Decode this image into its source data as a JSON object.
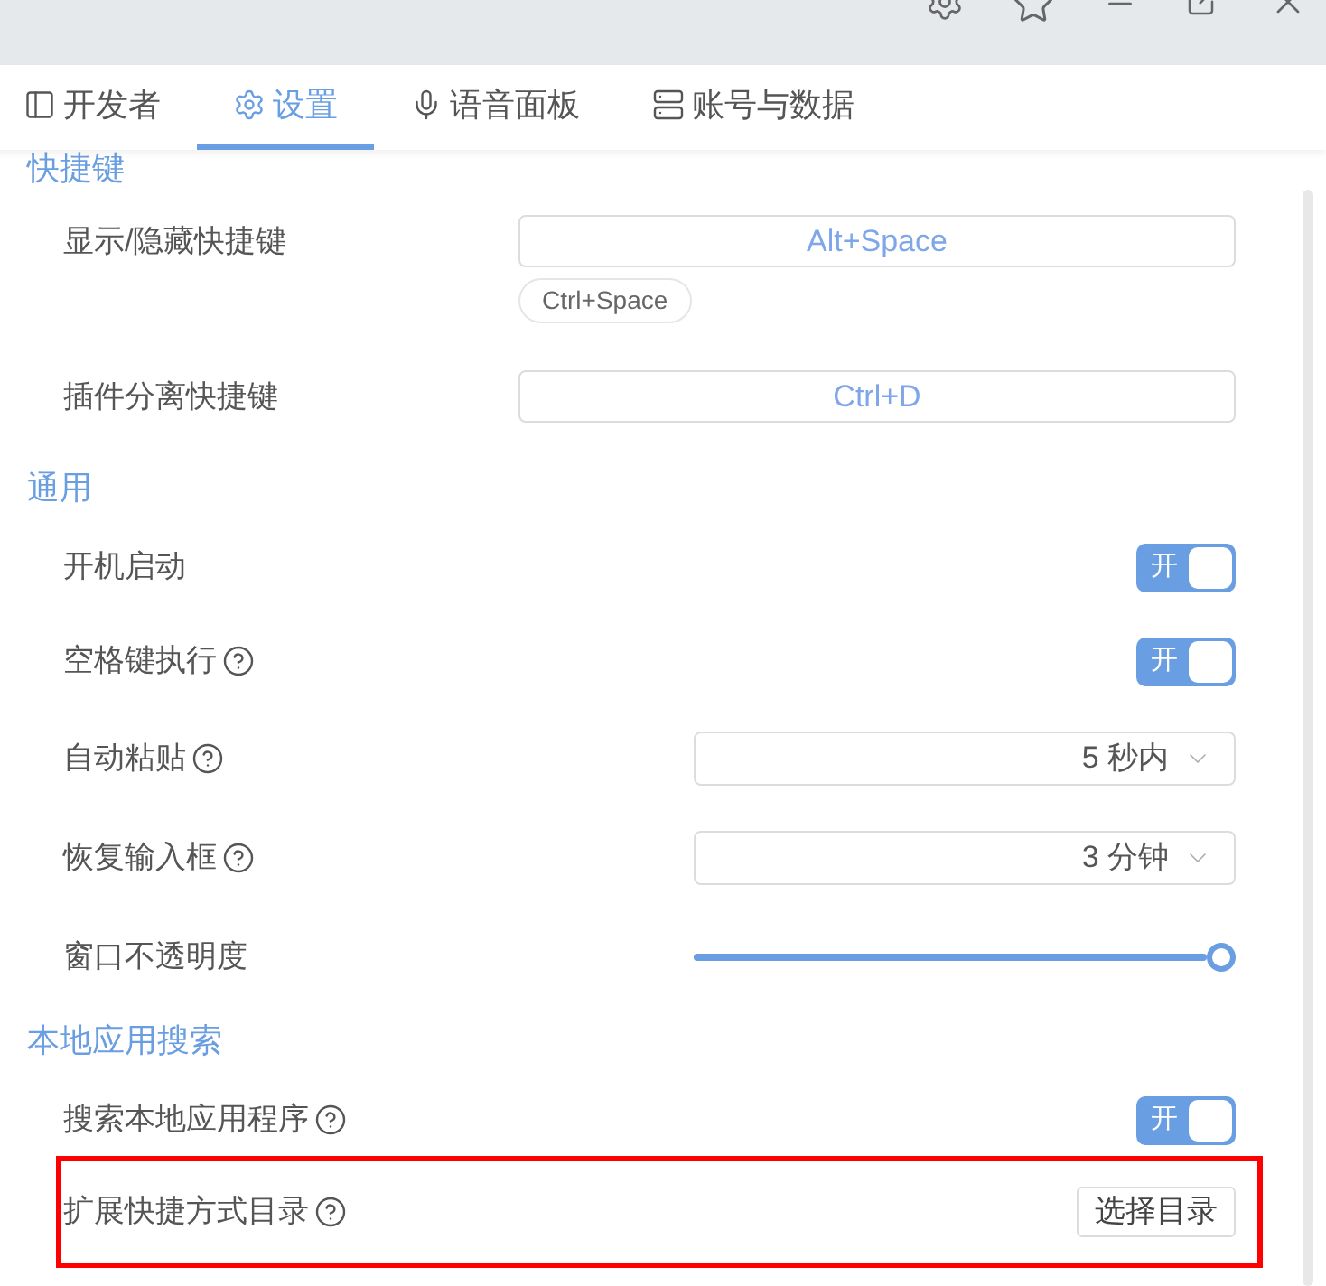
{
  "tabs": [
    {
      "label": "开发者",
      "selected": false
    },
    {
      "label": "设置",
      "selected": true
    },
    {
      "label": "语音面板",
      "selected": false
    },
    {
      "label": "账号与数据",
      "selected": false
    }
  ],
  "sections": [
    {
      "title": "快捷键",
      "rows": [
        {
          "kind": "shortcut",
          "label": "显示/隐藏快捷键",
          "help": false,
          "value": "Alt+Space",
          "hint": "Ctrl+Space"
        },
        {
          "kind": "shortcut",
          "label": "插件分离快捷键",
          "help": false,
          "value": "Ctrl+D"
        }
      ]
    },
    {
      "title": "通用",
      "rows": [
        {
          "kind": "toggle",
          "label": "开机启动",
          "help": false,
          "on": true,
          "on_label": "开"
        },
        {
          "kind": "toggle",
          "label": "空格键执行",
          "help": true,
          "on": true,
          "on_label": "开"
        },
        {
          "kind": "select",
          "label": "自动粘贴",
          "help": true,
          "value": "5 秒内"
        },
        {
          "kind": "select",
          "label": "恢复输入框",
          "help": true,
          "value": "3 分钟"
        },
        {
          "kind": "slider",
          "label": "窗口不透明度",
          "help": false,
          "level": 1
        }
      ]
    },
    {
      "title": "本地应用搜索",
      "rows": [
        {
          "kind": "toggle",
          "label": "搜索本地应用程序",
          "help": true,
          "on": true,
          "on_label": "开"
        },
        {
          "kind": "button",
          "label": "扩展快捷方式目录",
          "help": true,
          "button": "选择目录",
          "highlighted": true
        }
      ]
    }
  ]
}
